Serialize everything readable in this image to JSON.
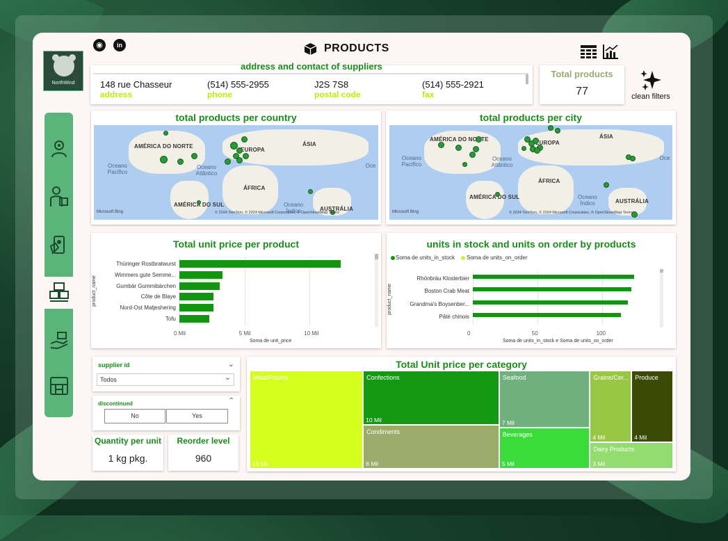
{
  "header": {
    "title": "PRODUCTS",
    "logo_text": "NorthWind"
  },
  "supplier_info": {
    "title": "address and contact of suppliers",
    "fields": [
      {
        "value": "148 rue Chasseur",
        "label": "address"
      },
      {
        "value": "(514) 555-2955",
        "label": "phone"
      },
      {
        "value": "J2S 7S8",
        "label": "postal code"
      },
      {
        "value": "(514) 555-2921",
        "label": "fax"
      }
    ]
  },
  "kpi_total_products": {
    "title": "Total products",
    "value": "77"
  },
  "clean_filters": {
    "label": "clean filters"
  },
  "map_country": {
    "title": "total products per country",
    "labels": {
      "na": "AMÉRICA DO NORTE",
      "eu": "EUROPA",
      "as": "ÁSIA",
      "pac": "Oceano Pacífico",
      "atl": "Oceano Atlântico",
      "af": "ÁFRICA",
      "sa": "AMÉRICA DO SUL",
      "ind": "Oceano Índico",
      "au": "AUSTRÁLIA",
      "oc": "Oce"
    },
    "bing": "Microsoft Bing",
    "attribution": "© 2024 TomTom, © 2024 Microsoft Corporation, © OpenStreetMap  Terms"
  },
  "map_city": {
    "title": "total products per city",
    "labels": {
      "na": "AMÉRICA DO NORTE",
      "eu": "EUROPA",
      "as": "ÁSIA",
      "pac": "Oceano Pacífico",
      "atl": "Oceano Atlântico",
      "af": "ÁFRICA",
      "sa": "AMÉRICA DO SUL",
      "ind": "Oceano Índico",
      "au": "AUSTRÁLIA",
      "oc": "Oce"
    },
    "bing": "Microsoft Bing",
    "attribution": "© 2024 TomTom, © 2024 Microsoft Corporation, © OpenStreetMap  Terms"
  },
  "chart_data": [
    {
      "type": "bar",
      "title": "Total unit price per product",
      "ylabel": "product_name",
      "xlabel": "Soma de unit_price",
      "categories": [
        "Thüringer Rostbratwurst",
        "Wimmers gute Semme...",
        "Gumbär Gummibärchen",
        "Côte de Blaye",
        "Nord-Ost Matjeshering",
        "Tofu"
      ],
      "values": [
        12.4,
        3.3,
        3.1,
        2.6,
        2.6,
        2.3
      ],
      "xticks": [
        "0 Mil",
        "5 Mil",
        "10 Mil"
      ],
      "xlim": [
        0,
        15
      ]
    },
    {
      "type": "bar",
      "title": "units in stock and units on order by products",
      "ylabel": "product_name",
      "xlabel": "Soma de units_in_stock e Soma de units_on_order",
      "legend": [
        "Soma de units_in_stock",
        "Soma de units_on_order"
      ],
      "categories": [
        "Rhönbräu Klosterbier",
        "Boston Crab Meat",
        "Grandma's Boysenber...",
        "Pâté chinois"
      ],
      "series": [
        {
          "name": "Soma de units_in_stock",
          "values": [
            125,
            123,
            120,
            115
          ]
        },
        {
          "name": "Soma de units_on_order",
          "values": [
            0,
            0,
            0,
            0
          ]
        }
      ],
      "xticks": [
        "0",
        "50",
        "100"
      ],
      "xlim": [
        0,
        145
      ]
    },
    {
      "type": "treemap",
      "title": "Total Unit price per category",
      "categories": [
        "Meat/Poultry",
        "Confections",
        "Condiments",
        "Seafood",
        "Beverages",
        "Grains/Cer...",
        "Produce",
        "Dairy Products"
      ],
      "values": [
        15,
        10,
        8,
        7,
        5,
        4,
        4,
        3
      ],
      "value_labels": [
        "15 Mil",
        "10 Mil",
        "8 Mil",
        "7 Mil",
        "5 Mil",
        "4 Mil",
        "4 Mil",
        "3 Mil"
      ],
      "colors": [
        "#d4fe1e",
        "#139a12",
        "#9aab6a",
        "#6fb07e",
        "#3adc3a",
        "#98c843",
        "#3c4a06",
        "#93dd6f"
      ]
    }
  ],
  "filters": {
    "supplier": {
      "label": "supplier id",
      "value": "Todos"
    },
    "discontinued": {
      "label": "discontinued",
      "options": [
        "No",
        "Yes"
      ]
    }
  },
  "kpi_quantity": {
    "title": "Quantity per unit",
    "value": "1 kg pkg."
  },
  "kpi_reorder": {
    "title": "Reorder level",
    "value": "960"
  },
  "colors": {
    "accent": "#1a8a1a",
    "sidebar": "#5bb57a",
    "label_lime": "#b8f000"
  }
}
